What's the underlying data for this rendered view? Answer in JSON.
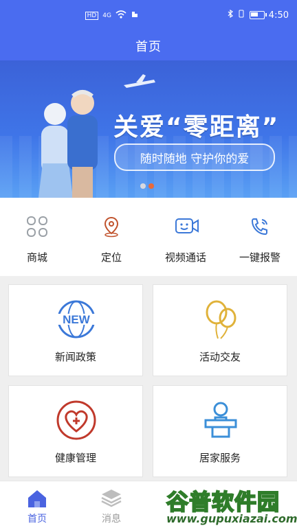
{
  "status_bar": {
    "time": "4:50",
    "net_label": "4G"
  },
  "header": {
    "title": "首页",
    "bg_color": "#4a6cf0"
  },
  "banner": {
    "headline": "关爱“零距离”",
    "subline": "随时随地  守护你的爱",
    "slide_count": 2,
    "active_index": 1
  },
  "quick_menu": [
    {
      "label": "商城",
      "icon": "grid-icon",
      "color": "#9aa0a6"
    },
    {
      "label": "定位",
      "icon": "location-pin-icon",
      "color": "#c0522c"
    },
    {
      "label": "视频通话",
      "icon": "video-call-icon",
      "color": "#3b78d8"
    },
    {
      "label": "一键报警",
      "icon": "phone-alarm-icon",
      "color": "#3b78d8"
    }
  ],
  "cards": [
    {
      "label": "新闻政策",
      "icon": "news-globe-icon",
      "color": "#3b78d8"
    },
    {
      "label": "活动交友",
      "icon": "balloons-icon",
      "color": "#e0b23a"
    },
    {
      "label": "健康管理",
      "icon": "heart-cross-icon",
      "color": "#c0392b"
    },
    {
      "label": "居家服务",
      "icon": "home-service-icon",
      "color": "#3b8fd8"
    }
  ],
  "tab_bar": [
    {
      "label": "首页",
      "active": true
    },
    {
      "label": "消息",
      "active": false
    }
  ],
  "watermark": {
    "brand": "谷普软件园",
    "url": "www.gupuxiazai.com"
  }
}
